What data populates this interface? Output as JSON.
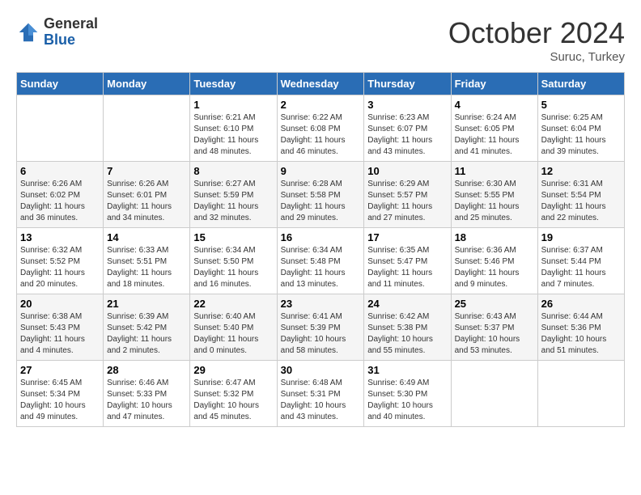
{
  "header": {
    "logo": {
      "line1": "General",
      "line2": "Blue"
    },
    "title": "October 2024",
    "subtitle": "Suruc, Turkey"
  },
  "days_of_week": [
    "Sunday",
    "Monday",
    "Tuesday",
    "Wednesday",
    "Thursday",
    "Friday",
    "Saturday"
  ],
  "weeks": [
    [
      {
        "day": "",
        "info": ""
      },
      {
        "day": "",
        "info": ""
      },
      {
        "day": "1",
        "info": "Sunrise: 6:21 AM\nSunset: 6:10 PM\nDaylight: 11 hours and 48 minutes."
      },
      {
        "day": "2",
        "info": "Sunrise: 6:22 AM\nSunset: 6:08 PM\nDaylight: 11 hours and 46 minutes."
      },
      {
        "day": "3",
        "info": "Sunrise: 6:23 AM\nSunset: 6:07 PM\nDaylight: 11 hours and 43 minutes."
      },
      {
        "day": "4",
        "info": "Sunrise: 6:24 AM\nSunset: 6:05 PM\nDaylight: 11 hours and 41 minutes."
      },
      {
        "day": "5",
        "info": "Sunrise: 6:25 AM\nSunset: 6:04 PM\nDaylight: 11 hours and 39 minutes."
      }
    ],
    [
      {
        "day": "6",
        "info": "Sunrise: 6:26 AM\nSunset: 6:02 PM\nDaylight: 11 hours and 36 minutes."
      },
      {
        "day": "7",
        "info": "Sunrise: 6:26 AM\nSunset: 6:01 PM\nDaylight: 11 hours and 34 minutes."
      },
      {
        "day": "8",
        "info": "Sunrise: 6:27 AM\nSunset: 5:59 PM\nDaylight: 11 hours and 32 minutes."
      },
      {
        "day": "9",
        "info": "Sunrise: 6:28 AM\nSunset: 5:58 PM\nDaylight: 11 hours and 29 minutes."
      },
      {
        "day": "10",
        "info": "Sunrise: 6:29 AM\nSunset: 5:57 PM\nDaylight: 11 hours and 27 minutes."
      },
      {
        "day": "11",
        "info": "Sunrise: 6:30 AM\nSunset: 5:55 PM\nDaylight: 11 hours and 25 minutes."
      },
      {
        "day": "12",
        "info": "Sunrise: 6:31 AM\nSunset: 5:54 PM\nDaylight: 11 hours and 22 minutes."
      }
    ],
    [
      {
        "day": "13",
        "info": "Sunrise: 6:32 AM\nSunset: 5:52 PM\nDaylight: 11 hours and 20 minutes."
      },
      {
        "day": "14",
        "info": "Sunrise: 6:33 AM\nSunset: 5:51 PM\nDaylight: 11 hours and 18 minutes."
      },
      {
        "day": "15",
        "info": "Sunrise: 6:34 AM\nSunset: 5:50 PM\nDaylight: 11 hours and 16 minutes."
      },
      {
        "day": "16",
        "info": "Sunrise: 6:34 AM\nSunset: 5:48 PM\nDaylight: 11 hours and 13 minutes."
      },
      {
        "day": "17",
        "info": "Sunrise: 6:35 AM\nSunset: 5:47 PM\nDaylight: 11 hours and 11 minutes."
      },
      {
        "day": "18",
        "info": "Sunrise: 6:36 AM\nSunset: 5:46 PM\nDaylight: 11 hours and 9 minutes."
      },
      {
        "day": "19",
        "info": "Sunrise: 6:37 AM\nSunset: 5:44 PM\nDaylight: 11 hours and 7 minutes."
      }
    ],
    [
      {
        "day": "20",
        "info": "Sunrise: 6:38 AM\nSunset: 5:43 PM\nDaylight: 11 hours and 4 minutes."
      },
      {
        "day": "21",
        "info": "Sunrise: 6:39 AM\nSunset: 5:42 PM\nDaylight: 11 hours and 2 minutes."
      },
      {
        "day": "22",
        "info": "Sunrise: 6:40 AM\nSunset: 5:40 PM\nDaylight: 11 hours and 0 minutes."
      },
      {
        "day": "23",
        "info": "Sunrise: 6:41 AM\nSunset: 5:39 PM\nDaylight: 10 hours and 58 minutes."
      },
      {
        "day": "24",
        "info": "Sunrise: 6:42 AM\nSunset: 5:38 PM\nDaylight: 10 hours and 55 minutes."
      },
      {
        "day": "25",
        "info": "Sunrise: 6:43 AM\nSunset: 5:37 PM\nDaylight: 10 hours and 53 minutes."
      },
      {
        "day": "26",
        "info": "Sunrise: 6:44 AM\nSunset: 5:36 PM\nDaylight: 10 hours and 51 minutes."
      }
    ],
    [
      {
        "day": "27",
        "info": "Sunrise: 6:45 AM\nSunset: 5:34 PM\nDaylight: 10 hours and 49 minutes."
      },
      {
        "day": "28",
        "info": "Sunrise: 6:46 AM\nSunset: 5:33 PM\nDaylight: 10 hours and 47 minutes."
      },
      {
        "day": "29",
        "info": "Sunrise: 6:47 AM\nSunset: 5:32 PM\nDaylight: 10 hours and 45 minutes."
      },
      {
        "day": "30",
        "info": "Sunrise: 6:48 AM\nSunset: 5:31 PM\nDaylight: 10 hours and 43 minutes."
      },
      {
        "day": "31",
        "info": "Sunrise: 6:49 AM\nSunset: 5:30 PM\nDaylight: 10 hours and 40 minutes."
      },
      {
        "day": "",
        "info": ""
      },
      {
        "day": "",
        "info": ""
      }
    ]
  ]
}
